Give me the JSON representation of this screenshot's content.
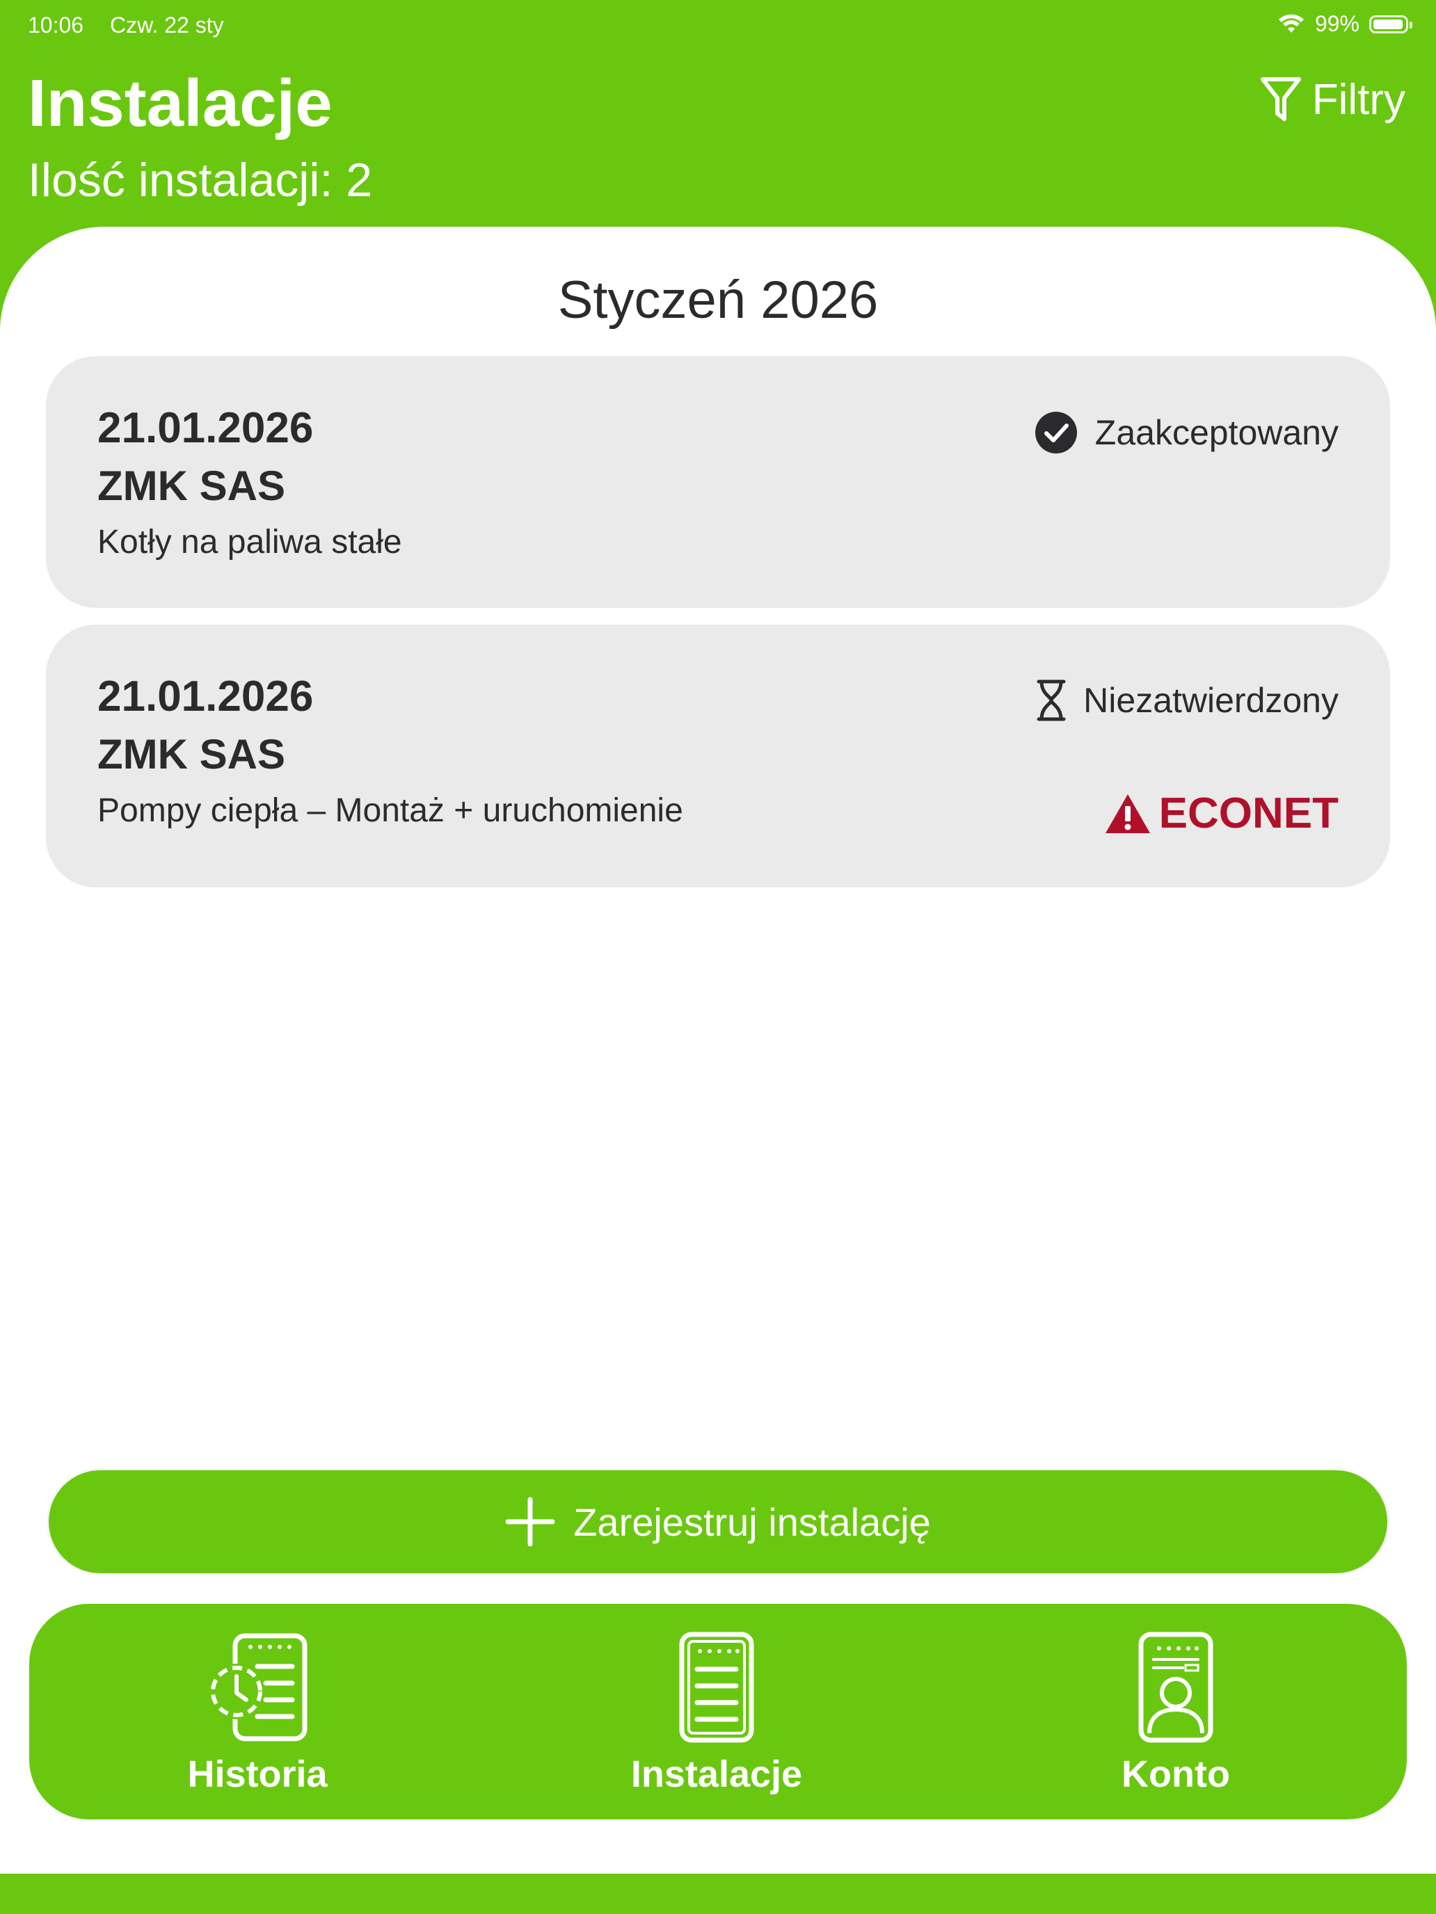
{
  "status_bar": {
    "time": "10:06",
    "date": "Czw. 22 sty",
    "battery": "99%"
  },
  "header": {
    "title": "Instalacje",
    "count_label": "Ilość instalacji: 2",
    "filter_label": "Filtry"
  },
  "month": "Styczeń 2026",
  "installations": [
    {
      "date": "21.01.2026",
      "company": "ZMK SAS",
      "type": "Kotły na paliwa stałe",
      "status": "Zaakceptowany",
      "status_icon": "check-circle-icon"
    },
    {
      "date": "21.01.2026",
      "company": "ZMK SAS",
      "type": "Pompy ciepła – Montaż + uruchomienie",
      "status": "Niezatwierdzony",
      "status_icon": "hourglass-icon",
      "warning": "ECONET"
    }
  ],
  "register_button": "Zarejestruj instalację",
  "tabs": [
    {
      "label": "Historia",
      "icon": "history-icon"
    },
    {
      "label": "Instalacje",
      "icon": "document-list-icon"
    },
    {
      "label": "Konto",
      "icon": "account-card-icon"
    }
  ],
  "colors": {
    "brand_green": "#6ac70f",
    "card_bg": "#eaeaea",
    "warning_red": "#b0102a",
    "text_dark": "#2b2b2e"
  }
}
